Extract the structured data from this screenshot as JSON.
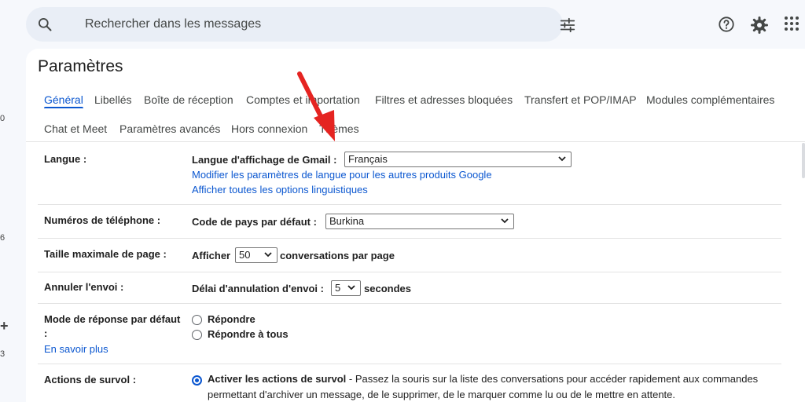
{
  "left_rail": {
    "numbers": [
      "0",
      "6",
      "3"
    ]
  },
  "search": {
    "placeholder": "Rechercher dans les messages",
    "icon": "search-icon",
    "filter_icon": "tune-icon"
  },
  "header_icons": [
    "help-icon",
    "gear-icon",
    "apps-grid-icon"
  ],
  "settings": {
    "title": "Paramètres",
    "tabs": [
      {
        "label": "Général",
        "active": true
      },
      {
        "label": "Libellés"
      },
      {
        "label": "Boîte de réception"
      },
      {
        "label": "Comptes et importation"
      },
      {
        "label": "Filtres et adresses bloquées"
      },
      {
        "label": "Transfert et POP/IMAP"
      },
      {
        "label": "Modules complémentaires"
      },
      {
        "label": "Chat et Meet"
      },
      {
        "label": "Paramètres avancés"
      },
      {
        "label": "Hors connexion"
      },
      {
        "label": "Thèmes"
      }
    ]
  },
  "rows": {
    "langue": {
      "label": "Langue :",
      "field_label": "Langue d'affichage de Gmail :",
      "value": "Français",
      "link1": "Modifier les paramètres de langue pour les autres produits Google",
      "link2": "Afficher toutes les options linguistiques"
    },
    "phone": {
      "label": "Numéros de téléphone :",
      "field_label": "Code de pays par défaut :",
      "value": "Burkina"
    },
    "page_size": {
      "label": "Taille maximale de page :",
      "prefix": "Afficher",
      "value": "50",
      "suffix": "conversations par page"
    },
    "undo": {
      "label": "Annuler l'envoi :",
      "field_label": "Délai d'annulation d'envoi :",
      "value": "5",
      "suffix": "secondes"
    },
    "reply": {
      "label": "Mode de réponse par défaut",
      "label_colon": ":",
      "learn_more": "En savoir plus",
      "option1": "Répondre",
      "option2": "Répondre à tous",
      "selected": "Répondre"
    },
    "hover": {
      "label": "Actions de survol :",
      "option_label": "Activer les actions de survol",
      "description": "- Passez la souris sur la liste des conversations pour accéder rapidement aux commandes permettant d'archiver un message, de le supprimer, de le marquer comme lu ou de le mettre en attente.",
      "selected": true
    }
  },
  "colors": {
    "accent": "#0b57d0",
    "arrow": "#e52421",
    "background": "#f6f8fc"
  }
}
